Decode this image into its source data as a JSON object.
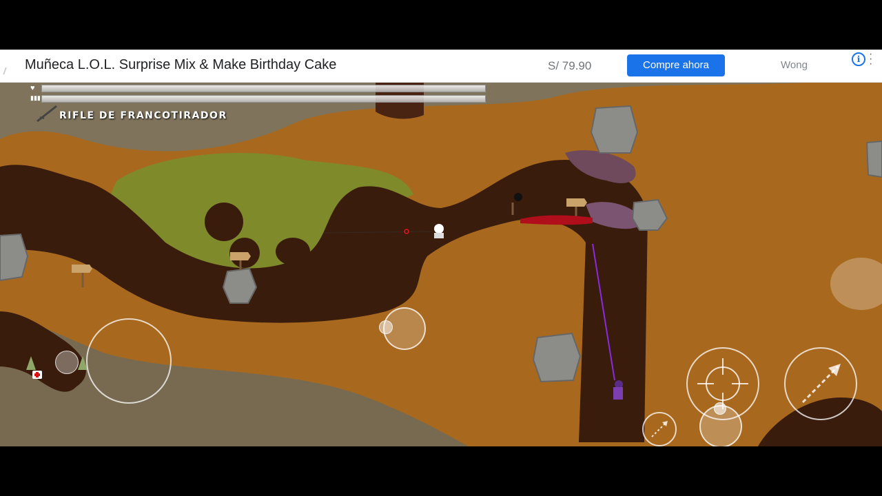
{
  "ad": {
    "title": "Muñeca L.O.L. Surprise Mix & Make Birthday Cake",
    "price": "S/ 79.90",
    "cta": "Compre ahora",
    "seller": "Wong",
    "info_icon": "info-icon",
    "menu_icon": "more-vert-icon",
    "cta_color": "#1a73e8"
  },
  "hud": {
    "weapon": "RIFLE DE FRANCOTIRADOR",
    "health_icon": "heart-icon",
    "ammo_icon": "ammo-icon",
    "health_fraction": 1.0,
    "ammo_fraction": 1.0
  },
  "controls": {
    "move_joystick": "joystick",
    "aim_stick": "aim-stick",
    "crosshair_button": "crosshair-icon",
    "throw_button": "throw-arrow-icon",
    "small_throw_button": "small-throw-icon"
  },
  "colors": {
    "dirt": "#a8691f",
    "tunnel": "#3a1c0c",
    "grass": "#7f8a2b",
    "rock": "#8a8a87",
    "fog": "#6f6f5c"
  }
}
